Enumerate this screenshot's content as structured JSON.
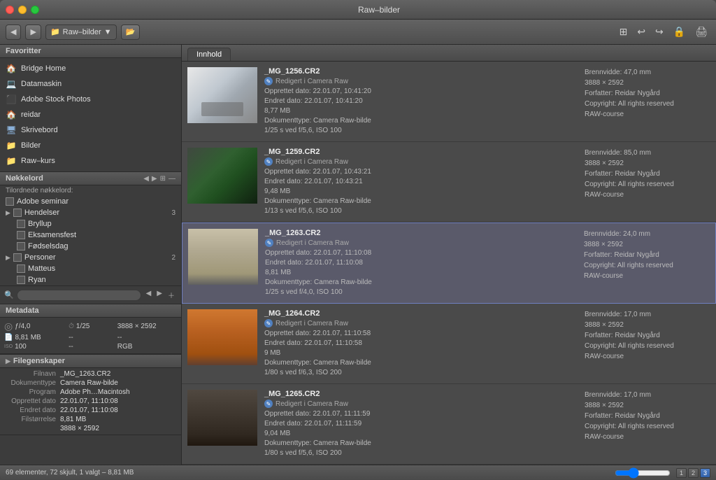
{
  "window": {
    "title": "Raw–bilder"
  },
  "toolbar": {
    "folder": "Raw–bilder",
    "back_label": "◀",
    "forward_label": "▶"
  },
  "sidebar": {
    "favorites_header": "Favoritter",
    "favorites": [
      {
        "id": "bridge-home",
        "icon": "🏠",
        "label": "Bridge Home"
      },
      {
        "id": "datamaskin",
        "icon": "💻",
        "label": "Datamaskin"
      },
      {
        "id": "adobe-stock",
        "icon": "🔴",
        "label": "Adobe Stock Photos"
      },
      {
        "id": "reidar",
        "icon": "🏠",
        "label": "reidar"
      },
      {
        "id": "skrivebord",
        "icon": "🖥️",
        "label": "Skrivebord"
      },
      {
        "id": "bilder",
        "icon": "📁",
        "label": "Bilder"
      },
      {
        "id": "raw-kurs",
        "icon": "📁",
        "label": "Raw–kurs"
      }
    ],
    "nokkelord_header": "Nøkkelord",
    "tilordnede_label": "Tilordnede nøkkelord:",
    "keywords": [
      {
        "id": "adobe-seminar",
        "label": "Adobe seminar",
        "count": "",
        "checked": false,
        "indent": 0
      },
      {
        "id": "hendelser",
        "label": "Hendelser",
        "count": "3",
        "checked": false,
        "indent": 0
      },
      {
        "id": "bryllup",
        "label": "Bryllup",
        "count": "",
        "checked": false,
        "indent": 1
      },
      {
        "id": "eksamensfest",
        "label": "Eksamensfest",
        "count": "",
        "checked": false,
        "indent": 1
      },
      {
        "id": "fodselsdag",
        "label": "Fødselsdag",
        "count": "",
        "checked": false,
        "indent": 1
      },
      {
        "id": "personer",
        "label": "Personer",
        "count": "2",
        "checked": false,
        "indent": 0
      },
      {
        "id": "matteus",
        "label": "Matteus",
        "count": "",
        "checked": false,
        "indent": 1
      },
      {
        "id": "ryan",
        "label": "Ryan",
        "count": "",
        "checked": false,
        "indent": 1
      }
    ]
  },
  "metadata_panel": {
    "header": "Metadata",
    "aperture": "ƒ/4,0",
    "shutter": "1/25",
    "dimensions": "3888 × 2592",
    "filesize": "8,81 MB",
    "dash1": "--",
    "dash2": "--",
    "iso_label": "ISO",
    "iso_value": "100",
    "dash3": "--",
    "colorspace": "RGB"
  },
  "file_properties": {
    "header": "Filegenskaper",
    "rows": [
      {
        "label": "Filnavn",
        "value": "_MG_1263.CR2"
      },
      {
        "label": "Dokumenttype",
        "value": "Camera Raw-bilde"
      },
      {
        "label": "Program",
        "value": "Adobe Ph…Macintosh"
      },
      {
        "label": "Opprettet dato",
        "value": "22.01.07, 11:10:08"
      },
      {
        "label": "Endret dato",
        "value": "22.01.07, 11:10:08"
      },
      {
        "label": "Filstørrelse",
        "value": "8,81 MB"
      }
    ]
  },
  "content": {
    "tab_label": "Innhold",
    "images": [
      {
        "id": "img1",
        "filename": "_MG_1256.CR2",
        "edited": "Redigert i Camera Raw",
        "opprettet": "Opprettet dato: 22.01.07, 10:41:20",
        "endret": "Endret dato: 22.01.07, 10:41:20",
        "size": "8,77 MB",
        "doctype": "Dokumenttype: Camera Raw-bilde",
        "exposure": "1/25 s ved f/5,6, ISO 100",
        "brennvidde": "Brennvidde: 47,0 mm",
        "dimensions": "3888 × 2592",
        "forfatter": "Forfatter: Reidar Nygård",
        "copyright": "Copyright: All rights reserved",
        "kurs": "RAW-course",
        "selected": false,
        "thumb": "snow"
      },
      {
        "id": "img2",
        "filename": "_MG_1259.CR2",
        "edited": "Redigert i Camera Raw",
        "opprettet": "Opprettet dato: 22.01.07, 10:43:21",
        "endret": "Endret dato: 22.01.07, 10:43:21",
        "size": "9,48 MB",
        "doctype": "Dokumenttype: Camera Raw-bilde",
        "exposure": "1/13 s ved f/5,6, ISO 100",
        "brennvidde": "Brennvidde: 85,0 mm",
        "dimensions": "3888 × 2592",
        "forfatter": "Forfatter: Reidar Nygård",
        "copyright": "Copyright: All rights reserved",
        "kurs": "RAW-course",
        "selected": false,
        "thumb": "forest"
      },
      {
        "id": "img3",
        "filename": "_MG_1263.CR2",
        "edited": "Redigert i Camera Raw",
        "opprettet": "Opprettet dato: 22.01.07, 11:10:08",
        "endret": "Endret dato: 22.01.07, 11:10:08",
        "size": "8,81 MB",
        "doctype": "Dokumenttype: Camera Raw-bilde",
        "exposure": "1/25 s ved f/4,0, ISO 100",
        "brennvidde": "Brennvidde: 24,0 mm",
        "dimensions": "3888 × 2592",
        "forfatter": "Forfatter: Reidar Nygård",
        "copyright": "Copyright: All rights reserved",
        "kurs": "RAW-course",
        "selected": true,
        "thumb": "building"
      },
      {
        "id": "img4",
        "filename": "_MG_1264.CR2",
        "edited": "Redigert i Camera Raw",
        "opprettet": "Opprettet dato: 22.01.07, 11:10:58",
        "endret": "Endret dato: 22.01.07, 11:10:58",
        "size": "9 MB",
        "doctype": "Dokumenttype: Camera Raw-bilde",
        "exposure": "1/80 s ved f/6,3, ISO 200",
        "brennvidde": "Brennvidde: 17,0 mm",
        "dimensions": "3888 × 2592",
        "forfatter": "Forfatter: Reidar Nygård",
        "copyright": "Copyright: All rights reserved",
        "kurs": "RAW-course",
        "selected": false,
        "thumb": "orange"
      },
      {
        "id": "img5",
        "filename": "_MG_1265.CR2",
        "edited": "Redigert i Camera Raw",
        "opprettet": "Opprettet dato: 22.01.07, 11:11:59",
        "endret": "Endret dato: 22.01.07, 11:11:59",
        "size": "9,04 MB",
        "doctype": "Dokumenttype: Camera Raw-bilde",
        "exposure": "1/80 s ved f/5,6, ISO 200",
        "brennvidde": "Brennvidde: 17,0 mm",
        "dimensions": "3888 × 2592",
        "forfatter": "Forfatter: Reidar Nygård",
        "copyright": "Copyright: All rights reserved",
        "kurs": "RAW-course",
        "selected": false,
        "thumb": "dark"
      }
    ]
  },
  "status_bar": {
    "text": "69 elementer, 72 skjult, 1 valgt – 8,81 MB"
  }
}
